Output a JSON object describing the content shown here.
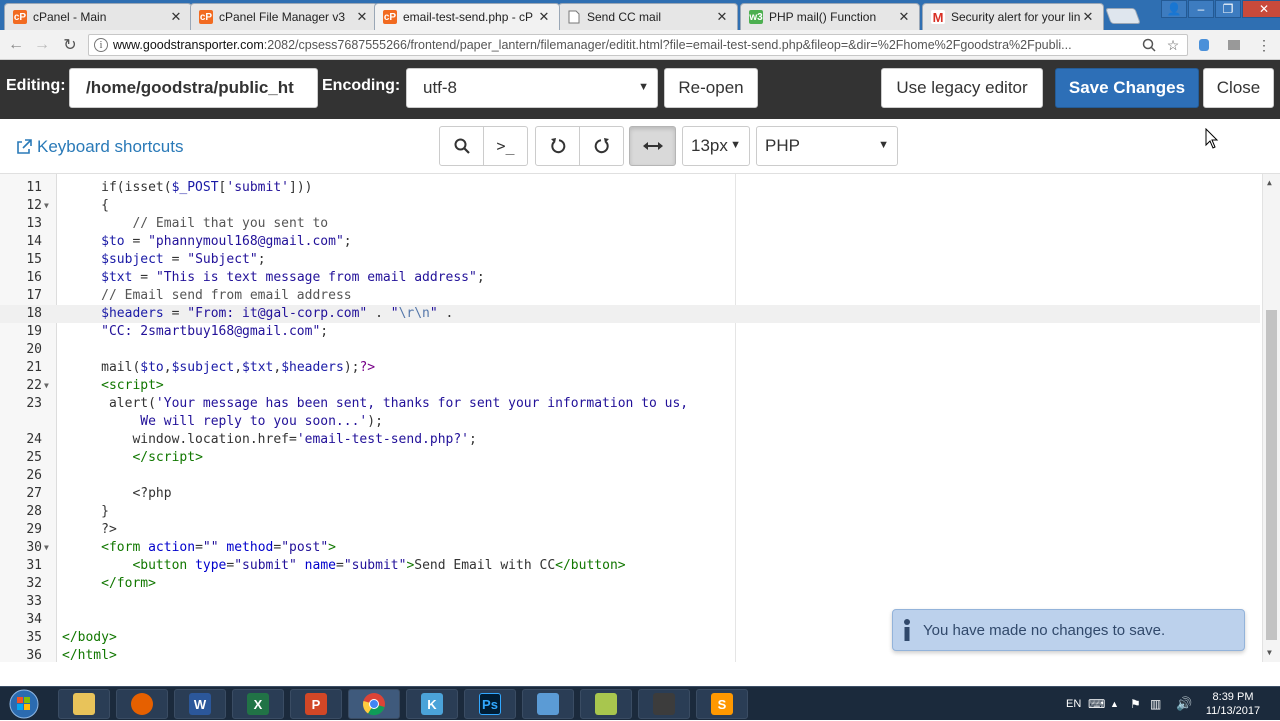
{
  "browser": {
    "tabs": [
      {
        "title": "cPanel - Main",
        "icon": "cpanel-icon",
        "color": "#f26b21"
      },
      {
        "title": "cPanel File Manager v3",
        "icon": "cpanel-icon",
        "color": "#f26b21"
      },
      {
        "title": "email-test-send.php - cP",
        "icon": "cpanel-icon",
        "color": "#f26b21"
      },
      {
        "title": "Send CC mail",
        "icon": "page-icon",
        "color": "#888888"
      },
      {
        "title": "PHP mail() Function",
        "icon": "w3schools-icon",
        "color": "#4caf50"
      },
      {
        "title": "Security alert for your lin",
        "icon": "gmail-icon",
        "color": "#d93025"
      }
    ],
    "url_host": "www.goodstransporter.com",
    "url_rest": ":2082/cpsess7687555266/frontend/paper_lantern/filemanager/editit.html?file=email-test-send.php&fileop=&dir=%2Fhome%2Fgoodstra%2Fpubli..."
  },
  "editor_header": {
    "editing_label": "Editing:",
    "path": "/home/goodstra/public_ht",
    "encoding_label": "Encoding:",
    "encoding_value": "utf-8",
    "reopen": "Re-open",
    "legacy": "Use legacy editor",
    "save": "Save Changes",
    "close": "Close"
  },
  "editor_toolbar": {
    "shortcuts": "Keyboard shortcuts",
    "font_size": "13px",
    "mode": "PHP"
  },
  "toast": "You have made no changes to save.",
  "taskbar": {
    "language": "EN",
    "time": "8:39 PM",
    "date": "11/13/2017"
  },
  "colors": {
    "header_bg": "#333333",
    "primary": "#2d6fb7",
    "link": "#2a7ab8"
  }
}
